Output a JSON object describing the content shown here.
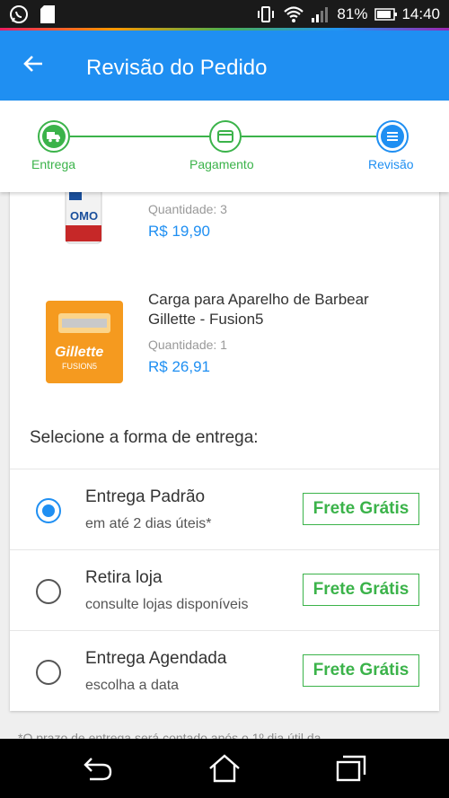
{
  "status": {
    "battery": "81%",
    "time": "14:40"
  },
  "appbar": {
    "title": "Revisão do Pedido"
  },
  "steps": [
    {
      "label": "Entrega",
      "icon": "truck-icon"
    },
    {
      "label": "Pagamento",
      "icon": "card-icon"
    },
    {
      "label": "Revisão",
      "icon": "list-icon"
    }
  ],
  "products": [
    {
      "name": "",
      "qty": "Quantidade:  3",
      "price": "R$ 19,90",
      "image": "detergent-bottle"
    },
    {
      "name": "Carga para Aparelho de Barbear Gillette - Fusion5",
      "qty": "Quantidade:  1",
      "price": "R$ 26,91",
      "image": "razor-pack"
    }
  ],
  "delivery": {
    "title": "Selecione a forma de entrega:",
    "options": [
      {
        "title": "Entrega Padrão",
        "subtitle": "em até 2 dias úteis*",
        "badge": "Frete Grátis",
        "selected": true
      },
      {
        "title": "Retira loja",
        "subtitle": "consulte lojas disponíveis",
        "badge": "Frete Grátis",
        "selected": false
      },
      {
        "title": "Entrega Agendada",
        "subtitle": "escolha a data",
        "badge": "Frete Grátis",
        "selected": false
      }
    ]
  },
  "footnote": "*O prazo de entrega será contado após o 1º dia útil da",
  "colors": {
    "primary": "#1f8ff2",
    "success": "#3bb34a"
  }
}
